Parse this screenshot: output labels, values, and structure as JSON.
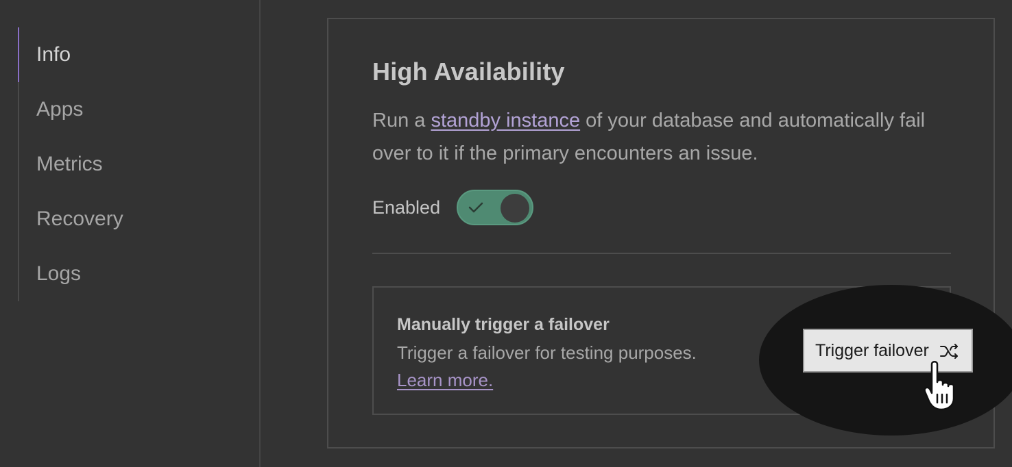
{
  "sidebar": {
    "items": [
      {
        "label": "Info",
        "active": true
      },
      {
        "label": "Apps"
      },
      {
        "label": "Metrics"
      },
      {
        "label": "Recovery"
      },
      {
        "label": "Logs"
      }
    ]
  },
  "ha": {
    "title": "High Availability",
    "desc_before": "Run a ",
    "desc_link": "standby instance",
    "desc_after": " of your database and automatically fail over to it if the primary encounters an issue.",
    "toggle_label": "Enabled",
    "toggle_on": true
  },
  "failover": {
    "title": "Manually trigger a failover",
    "desc": "Trigger a failover for testing purposes.",
    "learn_more": "Learn more.",
    "button_label": "Trigger failover",
    "button_icon": "shuffle-icon"
  },
  "colors": {
    "accent": "#8a6fc7",
    "toggle_on": "#4f8a72",
    "link": "#b3a3d6"
  }
}
